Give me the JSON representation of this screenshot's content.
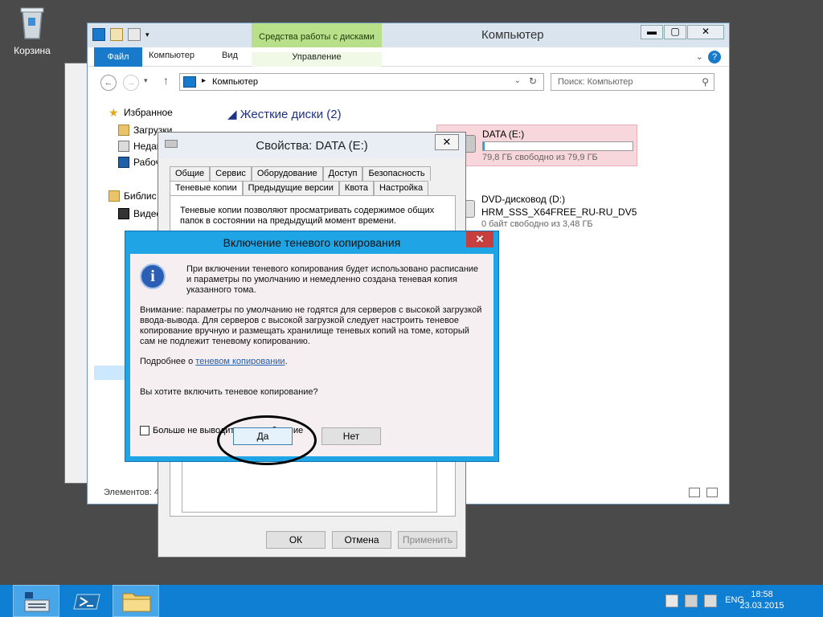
{
  "desktop": {
    "recycle_bin": "Корзина"
  },
  "explorer": {
    "title": "Компьютер",
    "contextual_tab_group": "Средства работы с дисками",
    "ribbon_tabs": [
      "Файл",
      "Компьютер",
      "Вид",
      "Управление"
    ],
    "address_path": "Компьютер",
    "search_placeholder": "Поиск: Компьютер",
    "nav": {
      "favorites": "Избранное",
      "downloads": "Загрузки",
      "recent": "Недав",
      "desktop": "Рабоч",
      "libraries": "Библис",
      "videos": "Видео"
    },
    "group_header": "Жесткие диски (2)",
    "drives": [
      {
        "name": "DATA (E:)",
        "free_text": "79,8 ГБ свободно из 79,9 ГБ",
        "used_fraction": 0.01
      },
      {
        "name": "DVD-дисковод (D:)",
        "label": "HRM_SSS_X64FREE_RU-RU_DV5",
        "free_text": "0 байт свободно из 3,48 ГБ"
      }
    ],
    "status_items": "Элементов: 4"
  },
  "properties": {
    "title": "Свойства: DATA (E:)",
    "tabs_row1": [
      "Общие",
      "Сервис",
      "Оборудование",
      "Доступ",
      "Безопасность"
    ],
    "tabs_row2": [
      "Теневые копии",
      "Предыдущие версии",
      "Квота",
      "Настройка"
    ],
    "intro": "Теневые копии позволяют просматривать содержимое общих папок в состоянии на предыдущий момент времени.",
    "ok": "ОК",
    "cancel": "Отмена",
    "apply": "Применить"
  },
  "dialog": {
    "title": "Включение теневого копирования",
    "p1": "При включении теневого копирования будет использовано расписание и параметры по умолчанию и немедленно создана теневая копия указанного тома.",
    "p2": "Внимание: параметры по умолчанию не годятся для серверов с высокой загрузкой ввода-вывода. Для серверов с высокой загрузкой следует настроить теневое копирование вручную и размещать хранилище теневых копий на томе, который сам не подлежит теневому копированию.",
    "more_prefix": "Подробнее о",
    "more_link": "теневом копировании",
    "more_suffix": ".",
    "question": "Вы хотите включить теневое копирование?",
    "checkbox": "Больше не выводить это сообщение",
    "yes": "Да",
    "no": "Нет"
  },
  "taskbar": {
    "lang": "ENG",
    "time": "18:58",
    "date": "23.03.2015"
  },
  "colors": {
    "accent": "#1fa5e6",
    "taskbar": "#0e7fd3",
    "selection": "#f7d7dc"
  }
}
